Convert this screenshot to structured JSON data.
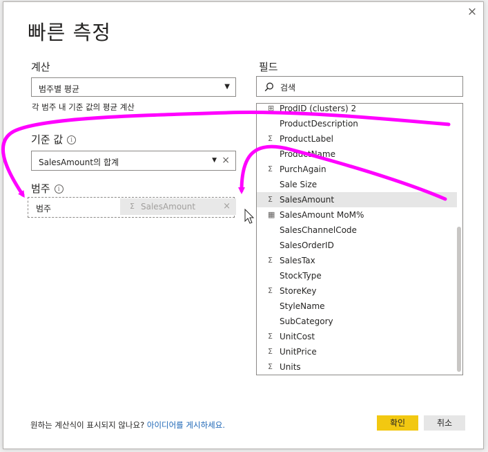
{
  "dialog": {
    "title": "빠른 측정",
    "close_glyph": "×"
  },
  "calculation": {
    "label": "계산",
    "selected": "범주별 평균",
    "hint": "각 범주 내 기준 값의 평균 계산"
  },
  "base_value": {
    "label": "기준 값",
    "value": "SalesAmount의 합계",
    "clear_glyph": "×"
  },
  "category": {
    "label": "범주",
    "placeholder": "범주",
    "dragging_field": "SalesAmount",
    "dragging_clear": "×"
  },
  "fields": {
    "label": "필드",
    "search_placeholder": "검색",
    "items": [
      {
        "label": "ProdID (clusters) 2",
        "icon": "hierarchy-icon"
      },
      {
        "label": "ProductDescription",
        "icon": ""
      },
      {
        "label": "ProductLabel",
        "icon": "sigma-icon"
      },
      {
        "label": "ProductName",
        "icon": ""
      },
      {
        "label": "PurchAgain",
        "icon": "sigma-icon"
      },
      {
        "label": "Sale Size",
        "icon": ""
      },
      {
        "label": "SalesAmount",
        "icon": "sigma-icon"
      },
      {
        "label": "SalesAmount MoM%",
        "icon": "calculator-icon"
      },
      {
        "label": "SalesChannelCode",
        "icon": ""
      },
      {
        "label": "SalesOrderID",
        "icon": ""
      },
      {
        "label": "SalesTax",
        "icon": "sigma-icon"
      },
      {
        "label": "StockType",
        "icon": ""
      },
      {
        "label": "StoreKey",
        "icon": "sigma-icon"
      },
      {
        "label": "StyleName",
        "icon": ""
      },
      {
        "label": "SubCategory",
        "icon": ""
      },
      {
        "label": "UnitCost",
        "icon": "sigma-icon"
      },
      {
        "label": "UnitPrice",
        "icon": "sigma-icon"
      },
      {
        "label": "Units",
        "icon": "sigma-icon"
      }
    ]
  },
  "footer": {
    "question": "원하는 계산식이 표시되지 않나요?",
    "link": "아이디어를 게시하세요."
  },
  "buttons": {
    "ok": "확인",
    "cancel": "취소"
  },
  "colors": {
    "accent_yellow": "#f2c811",
    "annotation_magenta": "#ff00ff",
    "link_blue": "#1a64b5"
  }
}
